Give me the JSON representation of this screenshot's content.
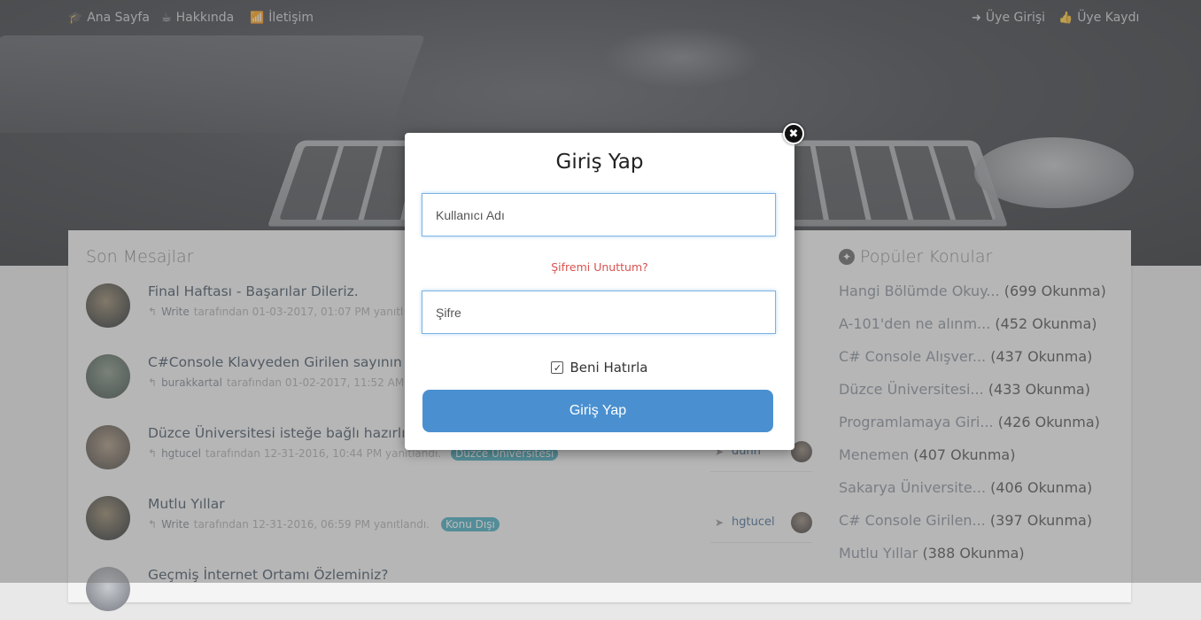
{
  "nav": {
    "left": [
      {
        "label": "Ana Sayfa",
        "icon": "graduation-cap-icon",
        "glyph": "🎓"
      },
      {
        "label": "Hakkında",
        "icon": "coffee-icon",
        "glyph": "☕"
      },
      {
        "label": "İletişim",
        "icon": "wifi-icon",
        "glyph": "📶"
      }
    ],
    "right": [
      {
        "label": "Üye Girişi",
        "icon": "sign-in-icon",
        "glyph": "➜"
      },
      {
        "label": "Üye Kaydı",
        "icon": "thumbs-up-icon",
        "glyph": "👍"
      }
    ]
  },
  "recent": {
    "title": "Son Mesajlar",
    "items": [
      {
        "title": "Final Haftası - Başarılar Dileriz.",
        "user": "Write",
        "meta": "tarafından 01-03-2017, 01:07 PM yanıtl",
        "tag": "",
        "last_user": ""
      },
      {
        "title": "C#Console Klavyeden Girilen sayının ta",
        "user": "burakkartal",
        "meta": "tarafından 01-02-2017, 11:52 AM",
        "tag": "",
        "last_user": ""
      },
      {
        "title": "Düzce Üniversitesi isteğe bağlı hazırlık",
        "user": "hgtucel",
        "meta": "tarafından 12-31-2016, 10:44 PM yanıtlandı.",
        "tag": "Düzce Üniversitesi",
        "last_user": "dunn"
      },
      {
        "title": "Mutlu Yıllar",
        "user": "Write",
        "meta": "tarafından 12-31-2016, 06:59 PM yanıtlandı.",
        "tag": "Konu Dışı",
        "last_user": "hgtucel"
      },
      {
        "title": "Geçmiş İnternet Ortamı Özleminiz?",
        "user": "",
        "meta": "",
        "tag": "",
        "last_user": ""
      }
    ]
  },
  "popular": {
    "title": "Popüler Konular",
    "icon": "fire-icon",
    "items": [
      {
        "title": "Hangi Bölümde Okuy...",
        "count": "(699 Okunma)"
      },
      {
        "title": "A-101'den ne alınm...",
        "count": "(452 Okunma)"
      },
      {
        "title": "C# Console Alışver...",
        "count": "(437 Okunma)"
      },
      {
        "title": "Düzce Üniversitesi...",
        "count": "(433 Okunma)"
      },
      {
        "title": "Programlamaya Giri...",
        "count": "(426 Okunma)"
      },
      {
        "title": "Menemen",
        "count": "(407 Okunma)"
      },
      {
        "title": "Sakarya Üniversite...",
        "count": "(406 Okunma)"
      },
      {
        "title": "C# Console Girilen...",
        "count": "(397 Okunma)"
      },
      {
        "title": "Mutlu Yıllar",
        "count": "(388 Okunma)"
      }
    ]
  },
  "modal": {
    "title": "Giriş Yap",
    "username_placeholder": "Kullanıcı Adı",
    "password_placeholder": "Şifre",
    "forgot_label": "Şifremi Unuttum?",
    "remember_label": "Beni Hatırla",
    "remember_checked": true,
    "submit_label": "Giriş Yap",
    "close_glyph": "✖"
  }
}
